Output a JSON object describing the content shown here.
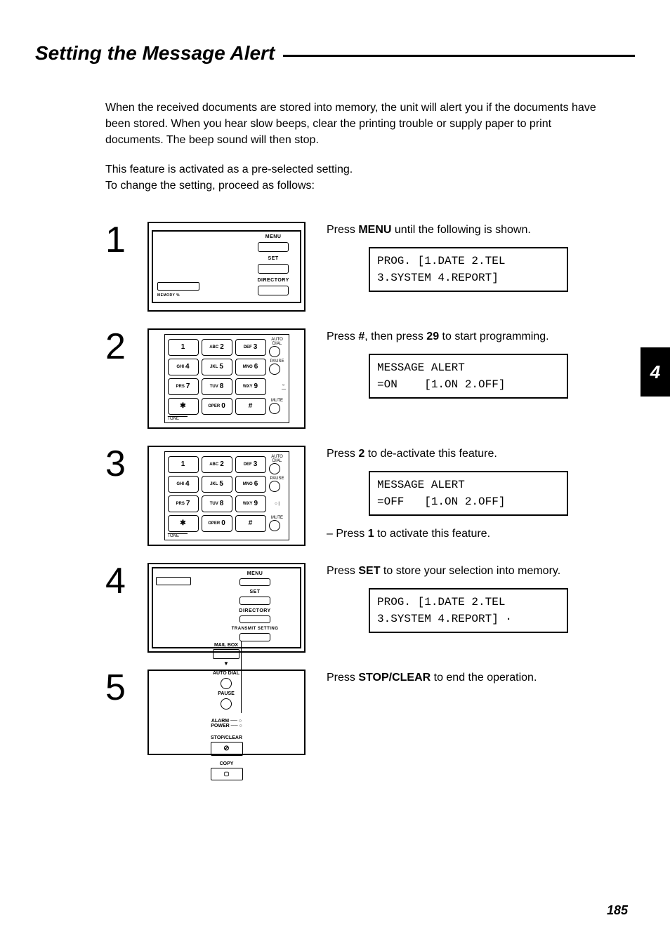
{
  "title": "Setting the Message Alert",
  "intro_p1": "When the received documents are stored into memory, the unit will alert you if the documents have been stored. When you hear slow beeps, clear the printing trouble or supply paper to print documents. The beep sound will then stop.",
  "intro_p2a": "This feature is activated as a pre-selected setting.",
  "intro_p2b": "To change the setting, proceed as follows:",
  "side_tab": "4",
  "page_number": "185",
  "labels": {
    "memory": "MEMORY %",
    "menu": "MENU",
    "set": "SET",
    "directory": "DIRECTORY",
    "transmit": "TRANSMIT SETTING",
    "autodial": "AUTO DIAL",
    "pause": "PAUSE",
    "mute": "MUTE",
    "tone": "TONE",
    "mailbox": "MAIL BOX",
    "alarm": "ALARM",
    "power": "POWER",
    "stopclear": "STOP/CLEAR",
    "copy": "COPY",
    "oper": "OPER"
  },
  "keys": {
    "k1": "1",
    "k2a": "ABC",
    "k2": "2",
    "k3a": "DEF",
    "k3": "3",
    "k4a": "GHI",
    "k4": "4",
    "k5a": "JKL",
    "k5": "5",
    "k6a": "MNO",
    "k6": "6",
    "k7a": "PRS",
    "k7": "7",
    "k8a": "TUV",
    "k8": "8",
    "k9a": "WXY",
    "k9": "9",
    "kstar": "✱",
    "k0": "0",
    "khash": "#"
  },
  "steps": [
    {
      "num": "1",
      "text_pre": "Press ",
      "text_bold": "MENU",
      "text_post": " until the following is shown.",
      "lcd": "PROG. [1.DATE 2.TEL\n3.SYSTEM 4.REPORT]"
    },
    {
      "num": "2",
      "text_pre": "Press ",
      "text_bold": "#",
      "text_mid": ", then press ",
      "text_bold2": "29",
      "text_post": " to start programming.",
      "lcd": "MESSAGE ALERT\n=ON    [1.ON 2.OFF]"
    },
    {
      "num": "3",
      "text_pre": "Press ",
      "text_bold": "2",
      "text_post": " to de-activate this feature.",
      "lcd": "MESSAGE ALERT\n=OFF   [1.ON 2.OFF]",
      "sub_pre": "– Press ",
      "sub_bold": "1",
      "sub_post": " to activate this feature."
    },
    {
      "num": "4",
      "text_pre": "Press ",
      "text_bold": "SET",
      "text_post": " to store your selection into memory.",
      "lcd": "PROG. [1.DATE 2.TEL\n3.SYSTEM 4.REPORT] ·"
    },
    {
      "num": "5",
      "text_pre": "Press ",
      "text_bold": "STOP/CLEAR",
      "text_post": " to end the operation."
    }
  ]
}
